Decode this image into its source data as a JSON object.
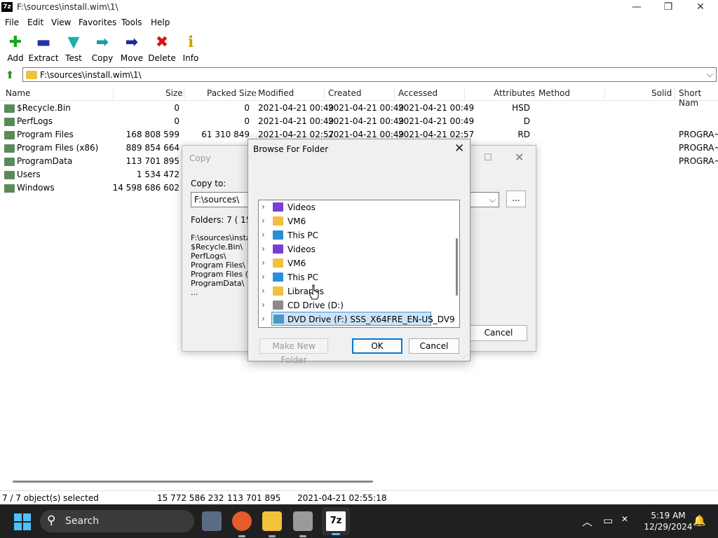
{
  "window": {
    "app_icon_text": "7z",
    "title": "F:\\sources\\install.wim\\1\\",
    "minimize": "—",
    "maximize": "❐",
    "close": "✕"
  },
  "menu": [
    "File",
    "Edit",
    "View",
    "Favorites",
    "Tools",
    "Help"
  ],
  "toolbar": [
    {
      "label": "Add",
      "glyph": "✚",
      "color": "#1aa51a"
    },
    {
      "label": "Extract",
      "glyph": "▬",
      "color": "#2233aa"
    },
    {
      "label": "Test",
      "glyph": "▼",
      "color": "#19b0b0"
    },
    {
      "label": "Copy",
      "glyph": "➡",
      "color": "#17a0a0"
    },
    {
      "label": "Move",
      "glyph": "➡",
      "color": "#1a2a9a"
    },
    {
      "label": "Delete",
      "glyph": "✖",
      "color": "#d01818"
    },
    {
      "label": "Info",
      "glyph": "ℹ",
      "color": "#c8a400"
    }
  ],
  "address": {
    "up_glyph": "⬆",
    "path": "F:\\sources\\install.wim\\1\\",
    "dropdown": "⌵"
  },
  "columns": [
    "Name",
    "Size",
    "Packed Size",
    "Modified",
    "Created",
    "Accessed",
    "Attributes",
    "Method",
    "Solid",
    "Short Nam"
  ],
  "files": [
    {
      "name": "$Recycle.Bin",
      "size": "0",
      "packed": "0",
      "modified": "2021-04-21 00:49",
      "created": "2021-04-21 00:49",
      "accessed": "2021-04-21 00:49",
      "attributes": "HSD",
      "short": ""
    },
    {
      "name": "PerfLogs",
      "size": "0",
      "packed": "0",
      "modified": "2021-04-21 00:49",
      "created": "2021-04-21 00:49",
      "accessed": "2021-04-21 00:49",
      "attributes": "D",
      "short": ""
    },
    {
      "name": "Program Files",
      "size": "168 808 599",
      "packed": "61 310 849",
      "modified": "2021-04-21 02:57",
      "created": "2021-04-21 00:49",
      "accessed": "2021-04-21 02:57",
      "attributes": "RD",
      "short": "PROGRA~"
    },
    {
      "name": "Program Files (x86)",
      "size": "889 854 664",
      "packed": "",
      "modified": "",
      "created": "",
      "accessed": "",
      "attributes": "",
      "short": "PROGRA~"
    },
    {
      "name": "ProgramData",
      "size": "113 701 895",
      "packed": "",
      "modified": "",
      "created": "",
      "accessed": "",
      "attributes": "",
      "short": "PROGRA~"
    },
    {
      "name": "Users",
      "size": "1 534 472",
      "packed": "",
      "modified": "",
      "created": "",
      "accessed": "",
      "attributes": "",
      "short": ""
    },
    {
      "name": "Windows",
      "size": "14 598 686 602",
      "packed": "",
      "modified": "",
      "created": "",
      "accessed": "",
      "attributes": "",
      "short": ""
    }
  ],
  "status": {
    "selected": "7 / 7 object(s) selected",
    "total": "15 772 586 232",
    "packed": "113 701 895",
    "date": "2021-04-21 02:55:18"
  },
  "copy_dialog": {
    "title": "Copy",
    "copy_to_label": "Copy to:",
    "path_value": "F:\\sources\\",
    "combo_arrow": "⌵",
    "browse_label": "...",
    "folders_info": "Folders: 7    ( 15 7",
    "path_lines": [
      "F:\\sources\\install",
      "  $Recycle.Bin\\",
      "  PerfLogs\\",
      "  Program Files\\",
      "  Program Files (x",
      "  ProgramData\\",
      "  ..."
    ],
    "cancel_label": "Cancel",
    "maximize": "☐",
    "close": "✕"
  },
  "browse_dialog": {
    "title": "Browse For Folder",
    "close": "✕",
    "chevron": "›",
    "grip": "⋰",
    "tree": [
      {
        "label": "Videos",
        "icon": "videos-icon",
        "color": "#7a3fd0"
      },
      {
        "label": "VM6",
        "icon": "folder-icon",
        "color": "#f0c040"
      },
      {
        "label": "This PC",
        "icon": "this-pc-icon",
        "color": "#2b8fd8"
      },
      {
        "label": "Videos",
        "icon": "videos-icon",
        "color": "#7a3fd0"
      },
      {
        "label": "VM6",
        "icon": "folder-icon",
        "color": "#f0c040"
      },
      {
        "label": "This PC",
        "icon": "this-pc-icon",
        "color": "#2b8fd8"
      },
      {
        "label": "Libraries",
        "icon": "libraries-icon",
        "color": "#f0c040"
      },
      {
        "label": "CD Drive (D:)",
        "icon": "cd-drive-icon",
        "color": "#8a8a8a"
      },
      {
        "label": "DVD Drive (F:) SSS_X64FRE_EN-US_DV9",
        "icon": "dvd-drive-icon",
        "color": "#4a9ac0"
      }
    ],
    "make_new_folder_label": "Make New Folder",
    "ok_label": "OK",
    "cancel_label": "Cancel"
  },
  "taskbar": {
    "search_placeholder": "Search",
    "search_glyph": "⚲",
    "time": "5:19 AM",
    "date": "12/29/2024",
    "chevron_up": "︿",
    "notification": "🔔",
    "network": "▭"
  }
}
